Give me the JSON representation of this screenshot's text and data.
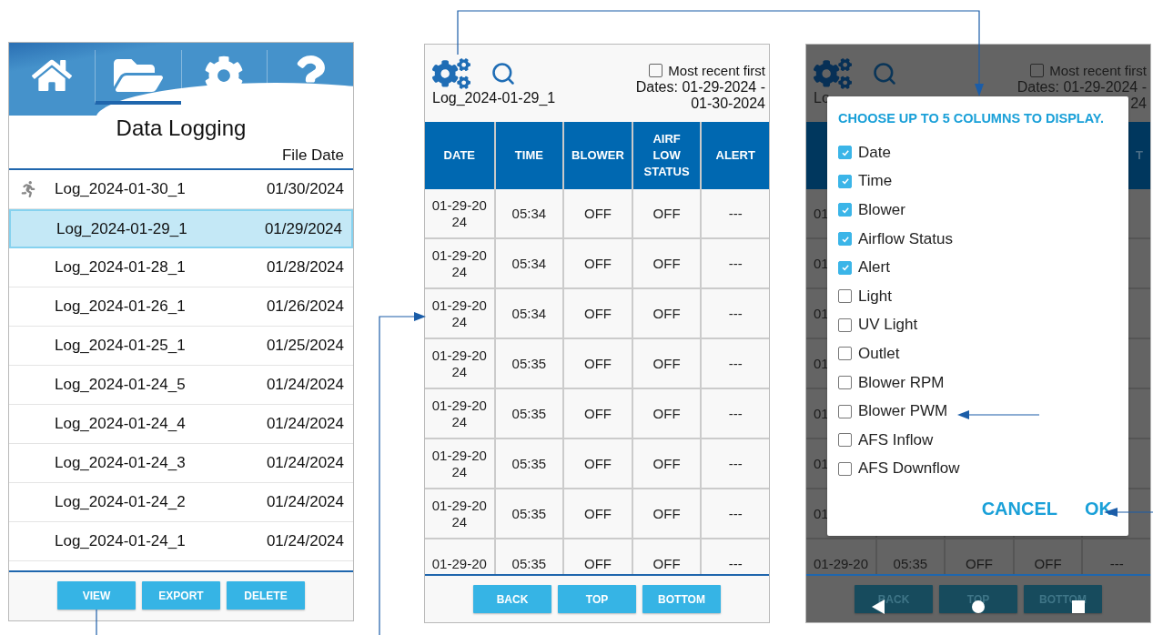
{
  "file_list": {
    "nav": [
      {
        "selected": false
      },
      {
        "selected": true
      },
      {
        "selected": false
      },
      {
        "selected": false
      }
    ],
    "title": "Data Logging",
    "column_header": "File Date",
    "files": [
      {
        "name": "Log_2024-01-30_1",
        "date": "01/30/2024",
        "recording": true,
        "selected": false
      },
      {
        "name": "Log_2024-01-29_1",
        "date": "01/29/2024",
        "recording": false,
        "selected": true
      },
      {
        "name": "Log_2024-01-28_1",
        "date": "01/28/2024",
        "recording": false,
        "selected": false
      },
      {
        "name": "Log_2024-01-26_1",
        "date": "01/26/2024",
        "recording": false,
        "selected": false
      },
      {
        "name": "Log_2024-01-25_1",
        "date": "01/25/2024",
        "recording": false,
        "selected": false
      },
      {
        "name": "Log_2024-01-24_5",
        "date": "01/24/2024",
        "recording": false,
        "selected": false
      },
      {
        "name": "Log_2024-01-24_4",
        "date": "01/24/2024",
        "recording": false,
        "selected": false
      },
      {
        "name": "Log_2024-01-24_3",
        "date": "01/24/2024",
        "recording": false,
        "selected": false
      },
      {
        "name": "Log_2024-01-24_2",
        "date": "01/24/2024",
        "recording": false,
        "selected": false
      },
      {
        "name": "Log_2024-01-24_1",
        "date": "01/24/2024",
        "recording": false,
        "selected": false
      }
    ],
    "buttons": [
      "VIEW",
      "EXPORT",
      "DELETE"
    ]
  },
  "log_view": {
    "log_name": "Log_2024-01-29_1",
    "sort_option": {
      "label": "Most recent first",
      "checked": false
    },
    "dates_line_1": "Dates: 01-29-2024 -",
    "dates_line_2": "01-30-2024",
    "columns": [
      "DATE",
      "TIME",
      "BLOWER",
      "AIRF LOW STATUS",
      "ALERT"
    ],
    "rows": [
      {
        "cells": [
          "01-29-2024",
          "05:34",
          "OFF",
          "OFF",
          "---"
        ]
      },
      {
        "cells": [
          "01-29-2024",
          "05:34",
          "OFF",
          "OFF",
          "---"
        ]
      },
      {
        "cells": [
          "01-29-2024",
          "05:34",
          "OFF",
          "OFF",
          "---"
        ]
      },
      {
        "cells": [
          "01-29-2024",
          "05:35",
          "OFF",
          "OFF",
          "---"
        ]
      },
      {
        "cells": [
          "01-29-2024",
          "05:35",
          "OFF",
          "OFF",
          "---"
        ]
      },
      {
        "cells": [
          "01-29-2024",
          "05:35",
          "OFF",
          "OFF",
          "---"
        ]
      },
      {
        "cells": [
          "01-29-2024",
          "05:35",
          "OFF",
          "OFF",
          "---"
        ]
      },
      {
        "cells": [
          "01-29-20",
          "05:35",
          "OFF",
          "OFF",
          "---"
        ]
      }
    ],
    "buttons": [
      "BACK",
      "TOP",
      "BOTTOM"
    ]
  },
  "column_dialog": {
    "background": {
      "log_name": "Lo",
      "sort_option": {
        "label": "Most recent first",
        "checked": false
      },
      "dates_line_1": "Dates: 01-29-2024 -",
      "dates_line_2": "24",
      "header_fragment": "T",
      "rows": [
        {
          "cells": [
            "01"
          ]
        },
        {
          "cells": [
            "01"
          ]
        },
        {
          "cells": [
            "01"
          ]
        },
        {
          "cells": [
            "01"
          ]
        },
        {
          "cells": [
            "01"
          ]
        },
        {
          "cells": [
            "01"
          ]
        },
        {
          "cells": [
            "01"
          ]
        },
        {
          "cells": [
            "01-29-20",
            "05:35",
            "OFF",
            "OFF",
            "---"
          ]
        }
      ],
      "buttons": [
        "BACK",
        "TOP",
        "BOTTOM"
      ]
    },
    "title": "CHOOSE UP TO 5 COLUMNS TO DISPLAY.",
    "options": [
      {
        "label": "Date",
        "checked": true
      },
      {
        "label": "Time",
        "checked": true
      },
      {
        "label": "Blower",
        "checked": true
      },
      {
        "label": "Airflow Status",
        "checked": true
      },
      {
        "label": "Alert",
        "checked": true
      },
      {
        "label": "Light",
        "checked": false
      },
      {
        "label": "UV Light",
        "checked": false
      },
      {
        "label": "Outlet",
        "checked": false
      },
      {
        "label": "Blower RPM",
        "checked": false
      },
      {
        "label": "Blower PWM",
        "checked": false
      },
      {
        "label": "AFS Inflow",
        "checked": false
      },
      {
        "label": "AFS Downflow",
        "checked": false
      }
    ],
    "actions": [
      "CANCEL",
      "OK"
    ]
  }
}
